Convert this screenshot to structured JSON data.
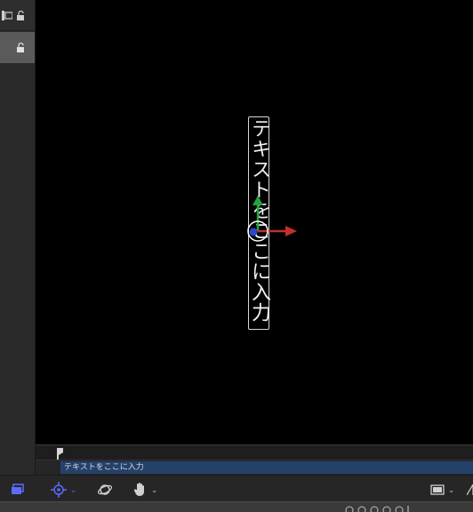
{
  "canvas": {
    "text_content": "テキストをここに入力"
  },
  "timeline": {
    "clip_label": "テキストをここに入力"
  },
  "toolbar": {
    "transform_tool_icon": "crosshair-icon",
    "orbit_tool_icon": "orbit-icon",
    "pan_tool_icon": "hand-icon",
    "view_layout_icon": "view-layout-icon"
  },
  "colors": {
    "accent": "#5b6cff",
    "clip": "#24416a",
    "x_axis": "#c0302a",
    "y_axis": "#23a33a"
  }
}
